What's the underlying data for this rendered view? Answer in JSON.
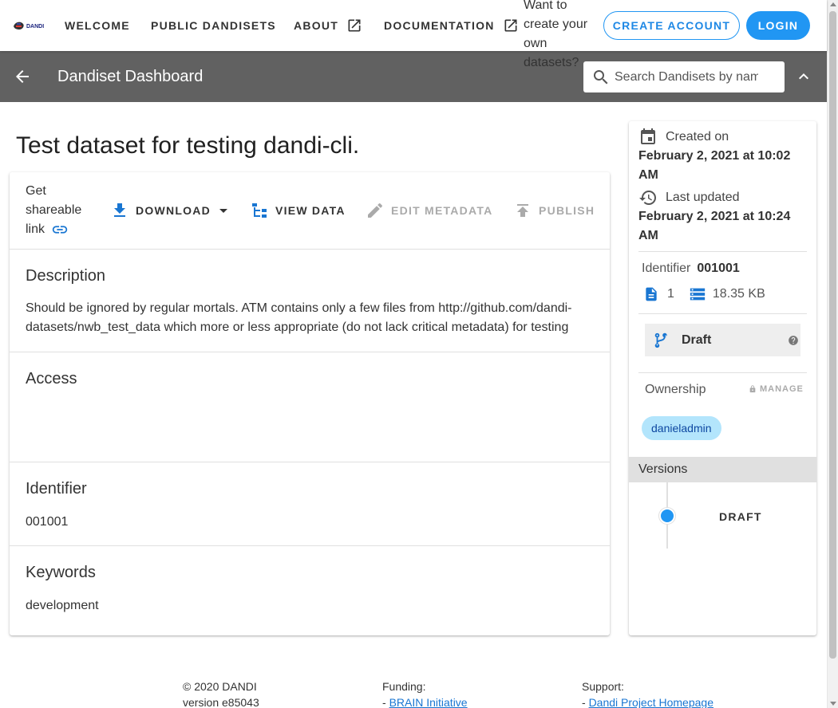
{
  "nav": {
    "items": [
      {
        "label": "WELCOME"
      },
      {
        "label": "PUBLIC DANDISETS"
      },
      {
        "label": "ABOUT"
      },
      {
        "label": "DOCUMENTATION"
      }
    ],
    "cta_text": "Want to create your own datasets?",
    "create_account": "CREATE ACCOUNT",
    "login": "LOGIN"
  },
  "dashboard": {
    "title": "Dandiset Dashboard",
    "search_placeholder": "Search Dandisets by name"
  },
  "dataset": {
    "title": "Test dataset for testing dandi-cli.",
    "actions": {
      "share": "Get shareable link",
      "download": "DOWNLOAD",
      "view_data": "VIEW DATA",
      "edit_metadata": "EDIT METADATA",
      "publish": "PUBLISH"
    },
    "sections": {
      "description_heading": "Description",
      "description_text": "Should be ignored by regular mortals. ATM contains only a few files from http://github.com/dandi-datasets/nwb_test_data which more or less appropriate (do not lack critical metadata) for testing",
      "access_heading": "Access",
      "identifier_heading": "Identifier",
      "identifier_value": "001001",
      "keywords_heading": "Keywords",
      "keywords_value": "development"
    }
  },
  "sidebar": {
    "created_label": "Created on",
    "created_value": "February 2, 2021 at 10:02 AM",
    "updated_label": "Last updated",
    "updated_value": "February 2, 2021 at 10:24 AM",
    "identifier_label": "Identifier",
    "identifier_value": "001001",
    "file_count": "1",
    "size": "18.35 KB",
    "version_status": "Draft",
    "ownership_label": "Ownership",
    "manage_label": "MANAGE",
    "owner": "danieladmin",
    "versions_heading": "Versions",
    "versions": [
      {
        "label": "DRAFT"
      }
    ]
  },
  "footer": {
    "copyright": "© 2020 DANDI",
    "version": "version e85043",
    "funding_label": "Funding:",
    "funding_link": "BRAIN Initiative",
    "support_label": "Support:",
    "support_link": "Dandi Project Homepage"
  },
  "colors": {
    "accent": "#2196f3",
    "dashbar": "#616161",
    "chip": "#b3e5fc"
  }
}
